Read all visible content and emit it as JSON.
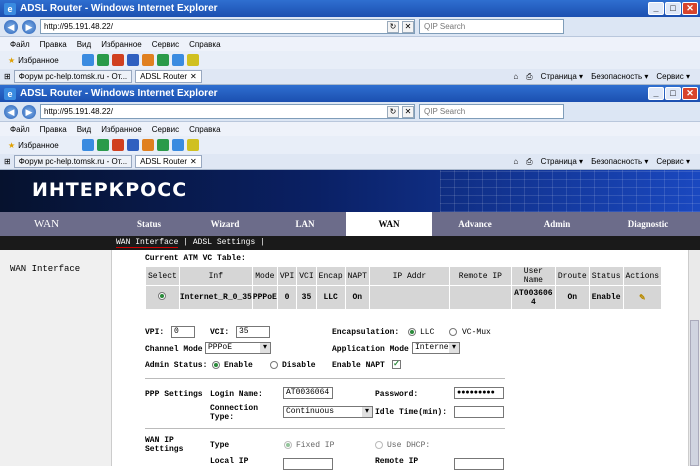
{
  "browser": {
    "title": "ADSL Router - Windows Internet Explorer",
    "address": "http://95.191.48.22/",
    "search_placeholder": "QIP Search",
    "menu": [
      "Файл",
      "Правка",
      "Вид",
      "Избранное",
      "Сервис",
      "Справка"
    ],
    "favorites_label": "Избранное",
    "tabs": [
      "Форум pc-help.tomsk.ru - От...",
      "ADSL Router"
    ],
    "cmds": [
      "Страница ▾",
      "Безопасность ▾",
      "Сервис ▾"
    ]
  },
  "router": {
    "logo": "ИНТЕРКРОСС",
    "section": "WAN",
    "menu": [
      "Status",
      "Wizard",
      "LAN",
      "WAN",
      "Advance",
      "Admin",
      "Diagnostic"
    ],
    "selected_menu": "WAN",
    "submenu": [
      "WAN Interface",
      "ADSL Settings"
    ],
    "sidebar_item": "WAN Interface",
    "table_title": "Current ATM VC Table:",
    "columns": [
      "Select",
      "Inf",
      "Mode",
      "VPI",
      "VCI",
      "Encap",
      "NAPT",
      "IP Addr",
      "Remote IP",
      "User Name",
      "Droute",
      "Status",
      "Actions"
    ],
    "row": {
      "inf": "Internet_R_0_35",
      "mode": "PPPoE",
      "vpi": "0",
      "vci": "35",
      "encap": "LLC",
      "napt": "On",
      "ip": "",
      "remote": "",
      "user": "AT0036064",
      "droute": "On",
      "status": "Enable"
    },
    "form": {
      "vpi_label": "VPI:",
      "vpi": "0",
      "vci_label": "VCI:",
      "vci": "35",
      "encap_label": "Encapsulation:",
      "llc": "LLC",
      "vcmux": "VC-Mux",
      "channel_mode_label": "Channel Mode",
      "channel_mode": "PPPoE",
      "app_mode_label": "Application Mode",
      "app_mode": "Internet",
      "admin_label": "Admin Status:",
      "enable": "Enable",
      "disable": "Disable",
      "napt_label": "Enable NAPT",
      "ppp_label": "PPP Settings",
      "login_label": "Login Name:",
      "login": "AT0036064",
      "password_label": "Password:",
      "password": "●●●●●●●●●",
      "conn_type_label": "Connection Type:",
      "conn_type": "Continuous",
      "idle_label": "Idle Time(min):",
      "wanip_label": "WAN IP Settings",
      "type_label": "Type",
      "fixed_ip": "Fixed IP",
      "dhcp": "Use DHCP:",
      "local_ip_label": "Local IP",
      "remote_ip_label": "Remote IP"
    }
  }
}
